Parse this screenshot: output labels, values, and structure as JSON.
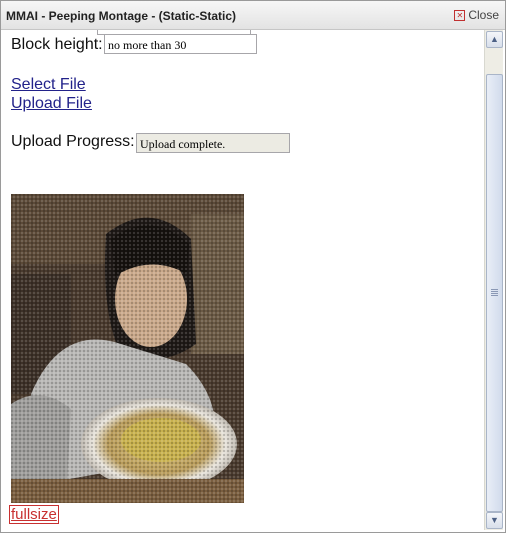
{
  "window": {
    "title": "MMAI - Peeping Montage - (Static-Static)",
    "close_label": "Close"
  },
  "form": {
    "block_height_label": "Block height:",
    "block_height_value": "no more than 30",
    "select_file": "Select File",
    "upload_file": "Upload File",
    "progress_label": "Upload Progress:",
    "progress_value": "Upload complete."
  },
  "result": {
    "image_label": "mosaic image of a person eating",
    "fullsize_link": "fullsize"
  },
  "icons": {
    "close": "close-icon",
    "scroll_up": "scroll-up-icon",
    "scroll_down": "scroll-down-icon"
  }
}
